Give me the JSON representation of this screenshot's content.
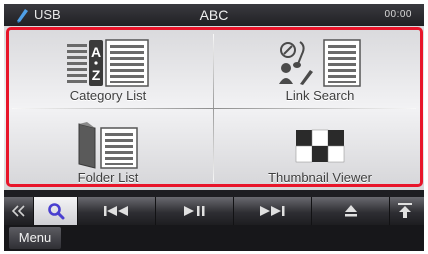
{
  "status": {
    "source": "USB",
    "title": "ABC",
    "clock": "00:00"
  },
  "search_menu": {
    "items": [
      {
        "label": "Category List",
        "icon": "category-list-icon"
      },
      {
        "label": "Link Search",
        "icon": "link-search-icon"
      },
      {
        "label": "Folder List",
        "icon": "folder-list-icon"
      },
      {
        "label": "Thumbnail Viewer",
        "icon": "thumbnail-viewer-icon"
      }
    ]
  },
  "controls": {
    "buttons": [
      "back-double-chevron",
      "search",
      "previous-track",
      "play-pause",
      "next-track",
      "eject",
      "upload"
    ]
  },
  "menubar": {
    "menu_label": "Menu"
  },
  "colors": {
    "highlight": "#e8152a",
    "panel": "#e6e6e9",
    "search_accent": "#4a3fd0"
  }
}
